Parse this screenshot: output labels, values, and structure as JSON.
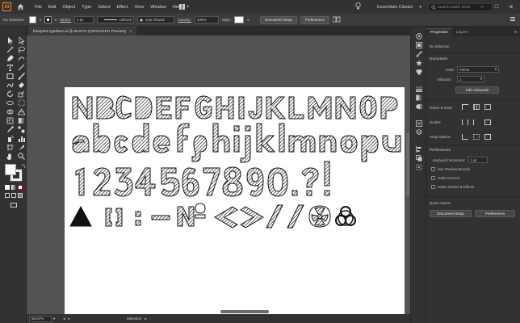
{
  "app": {
    "logo": "Ai"
  },
  "menu": [
    "File",
    "Edit",
    "Object",
    "Type",
    "Select",
    "Effect",
    "View",
    "Window",
    "Help"
  ],
  "workspace": "Essentials Classic",
  "search": {
    "placeholder": "Search Adobe Stock"
  },
  "control_bar": {
    "selection": "No Selection",
    "stroke_label": "Stroke:",
    "stroke_weight": "1 pt",
    "profile": "Uniform",
    "brush": "5 pt. Round",
    "opacity_label": "Opacity:",
    "opacity": "100%",
    "style_label": "Style:",
    "document_setup": "Document Setup",
    "preferences": "Preferences"
  },
  "document_tab": {
    "title": "blueprint typeface.ai @ 66.67% (CMYK/GPU Preview)",
    "close": "×"
  },
  "status": {
    "zoom": "66.67%",
    "mode": "Selection"
  },
  "properties_panel": {
    "tabs": [
      "Properties",
      "Layers"
    ],
    "no_selection": "No Selection",
    "document": "Document",
    "units_label": "Units:",
    "units": "Points",
    "artboard_label": "Artboard:",
    "artboard": "1",
    "edit_artboards": "Edit Artboards",
    "rulers_grids": "Rulers & Grids",
    "guides": "Guides",
    "snap_options": "Snap Options",
    "preferences": "Preferences",
    "keyboard_increment_label": "Keyboard Increment:",
    "keyboard_increment": "1 pt",
    "use_preview_bounds": "Use Preview Bounds",
    "scale_corners": "Scale Corners",
    "scale_strokes": "Scale Strokes & Effects",
    "quick_actions": "Quick Actions",
    "doc_setup_btn": "Document Setup",
    "preferences_btn": "Preferences"
  },
  "colors": {
    "accent": "#ff8a2b",
    "canvas": "#535353",
    "ui_dark": "#323232"
  }
}
